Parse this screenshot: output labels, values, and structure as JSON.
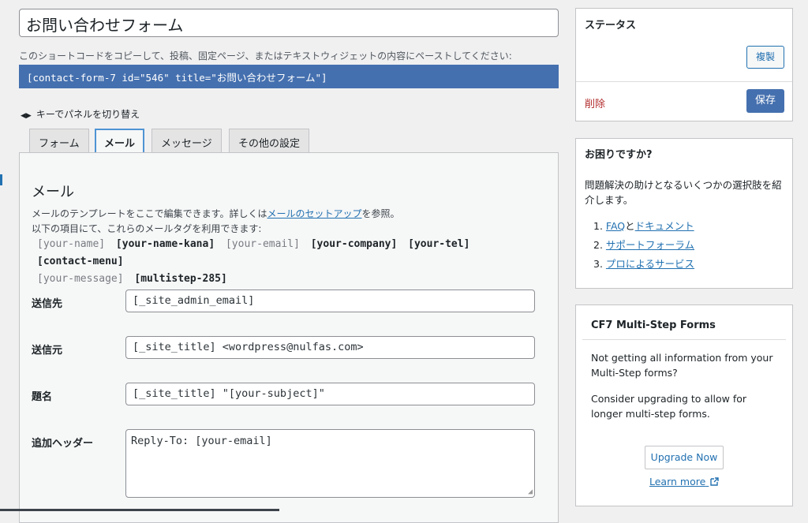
{
  "editor": {
    "title": "お問い合わせフォーム",
    "shortcode_hint": "このショートコードをコピーして、投稿、固定ページ、またはテキストウィジェットの内容にペーストしてください:",
    "shortcode": "[contact-form-7 id=\"546\" title=\"お問い合わせフォーム\"]",
    "panel_toggle_icon": "◀▶",
    "panel_toggle": "キーでパネルを切り替え"
  },
  "tabs": [
    {
      "label": "フォーム",
      "active": false
    },
    {
      "label": "メール",
      "active": true
    },
    {
      "label": "メッセージ",
      "active": false
    },
    {
      "label": "その他の設定",
      "active": false
    }
  ],
  "mail": {
    "heading": "メール",
    "desc_prefix": "メールのテンプレートをここで編集できます。詳しくは",
    "desc_link": "メールのセットアップ",
    "desc_suffix": "を参照。",
    "desc2": "以下の項目にて、これらのメールタグを利用できます:",
    "tags": [
      {
        "text": "[your-name]",
        "used": false
      },
      {
        "text": "[your-name-kana]",
        "used": true
      },
      {
        "text": "[your-email]",
        "used": false
      },
      {
        "text": "[your-company]",
        "used": true
      },
      {
        "text": "[your-tel]",
        "used": true
      },
      {
        "text": "[contact-menu]",
        "used": true
      },
      {
        "text": "[your-message]",
        "used": false
      },
      {
        "text": "[multistep-285]",
        "used": true
      }
    ],
    "fields": {
      "to_label": "送信先",
      "to_value": "[_site_admin_email]",
      "from_label": "送信元",
      "from_value": "[_site_title] <wordpress@nulfas.com>",
      "subject_label": "題名",
      "subject_value": "[_site_title] \"[your-subject]\"",
      "headers_label": "追加ヘッダー",
      "headers_value": "Reply-To: [your-email]"
    }
  },
  "status": {
    "title": "ステータス",
    "duplicate": "複製",
    "delete": "削除",
    "save": "保存"
  },
  "help": {
    "title": "お困りですか?",
    "text": "問題解決の助けとなるいくつかの選択肢を紹介します。",
    "item1_num": "1.",
    "item1_link_a": "FAQ",
    "item1_mid": "と",
    "item1_link_b": "ドキュメント",
    "item2_num": "2.",
    "item2_link": "サポートフォーラム",
    "item3_num": "3.",
    "item3_link": "プロによるサービス"
  },
  "cf7": {
    "title": "CF7 Multi-Step Forms",
    "text1": "Not getting all information from your Multi-Step forms?",
    "text2": "Consider upgrading to allow for longer multi-step forms.",
    "upgrade": "Upgrade Now",
    "learn_more": "Learn more",
    "external_icon": "external-link-icon"
  }
}
